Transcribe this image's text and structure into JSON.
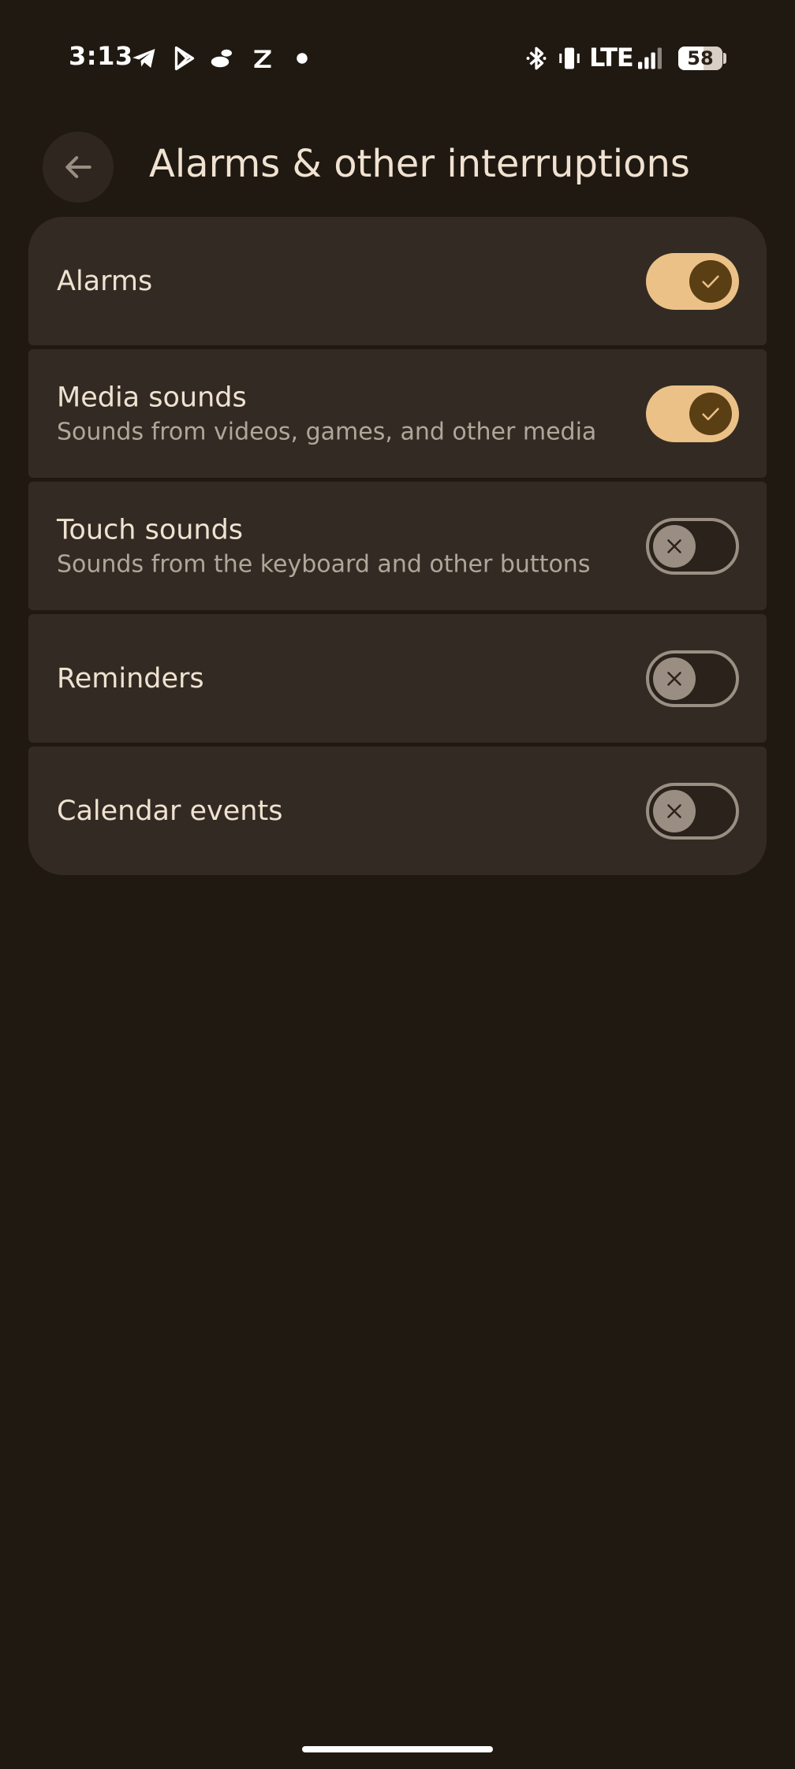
{
  "status_bar": {
    "time": "3:13",
    "left_icons": [
      "telegram-icon",
      "play-store-icon",
      "cloud-app-icon",
      "z-app-icon",
      "notification-dot-icon"
    ],
    "right_icons": [
      "bluetooth-icon",
      "vibrate-icon",
      "lte-icon",
      "signal-icon",
      "battery-icon"
    ],
    "network": "LTE",
    "battery_percent": "58"
  },
  "header": {
    "back_icon": "arrow-back-icon",
    "title": "Alarms & other interruptions"
  },
  "settings": [
    {
      "title": "Alarms",
      "subtitle": "",
      "enabled": true
    },
    {
      "title": "Media sounds",
      "subtitle": "Sounds from videos, games, and other media",
      "enabled": true
    },
    {
      "title": "Touch sounds",
      "subtitle": "Sounds from the keyboard and other buttons",
      "enabled": false
    },
    {
      "title": "Reminders",
      "subtitle": "",
      "enabled": false
    },
    {
      "title": "Calendar events",
      "subtitle": "",
      "enabled": false
    }
  ],
  "colors": {
    "background": "#201912",
    "card": "#332b23",
    "switch_on_track": "#ebc187",
    "switch_on_thumb": "#5a3e14",
    "switch_off_thumb": "#9a8e82",
    "text_primary": "#f0e2d1",
    "text_secondary": "#b2a69a"
  }
}
